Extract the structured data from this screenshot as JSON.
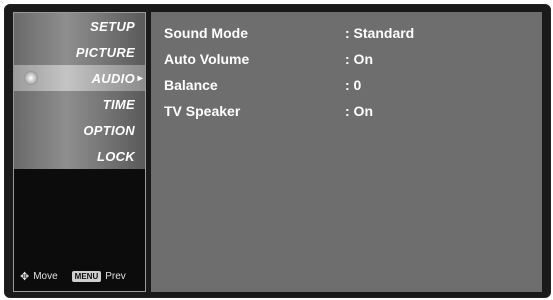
{
  "menu": {
    "items": [
      {
        "label": "SETUP"
      },
      {
        "label": "PICTURE"
      },
      {
        "label": "AUDIO"
      },
      {
        "label": "TIME"
      },
      {
        "label": "OPTION"
      },
      {
        "label": "LOCK"
      }
    ],
    "selected": "AUDIO"
  },
  "footer": {
    "move_label": "Move",
    "menu_key": "MENU",
    "prev_label": "Prev"
  },
  "settings": [
    {
      "label": "Sound Mode",
      "value": ": Standard"
    },
    {
      "label": "Auto Volume",
      "value": ": On"
    },
    {
      "label": "Balance",
      "value": ": 0"
    },
    {
      "label": "TV Speaker",
      "value": ": On"
    }
  ]
}
